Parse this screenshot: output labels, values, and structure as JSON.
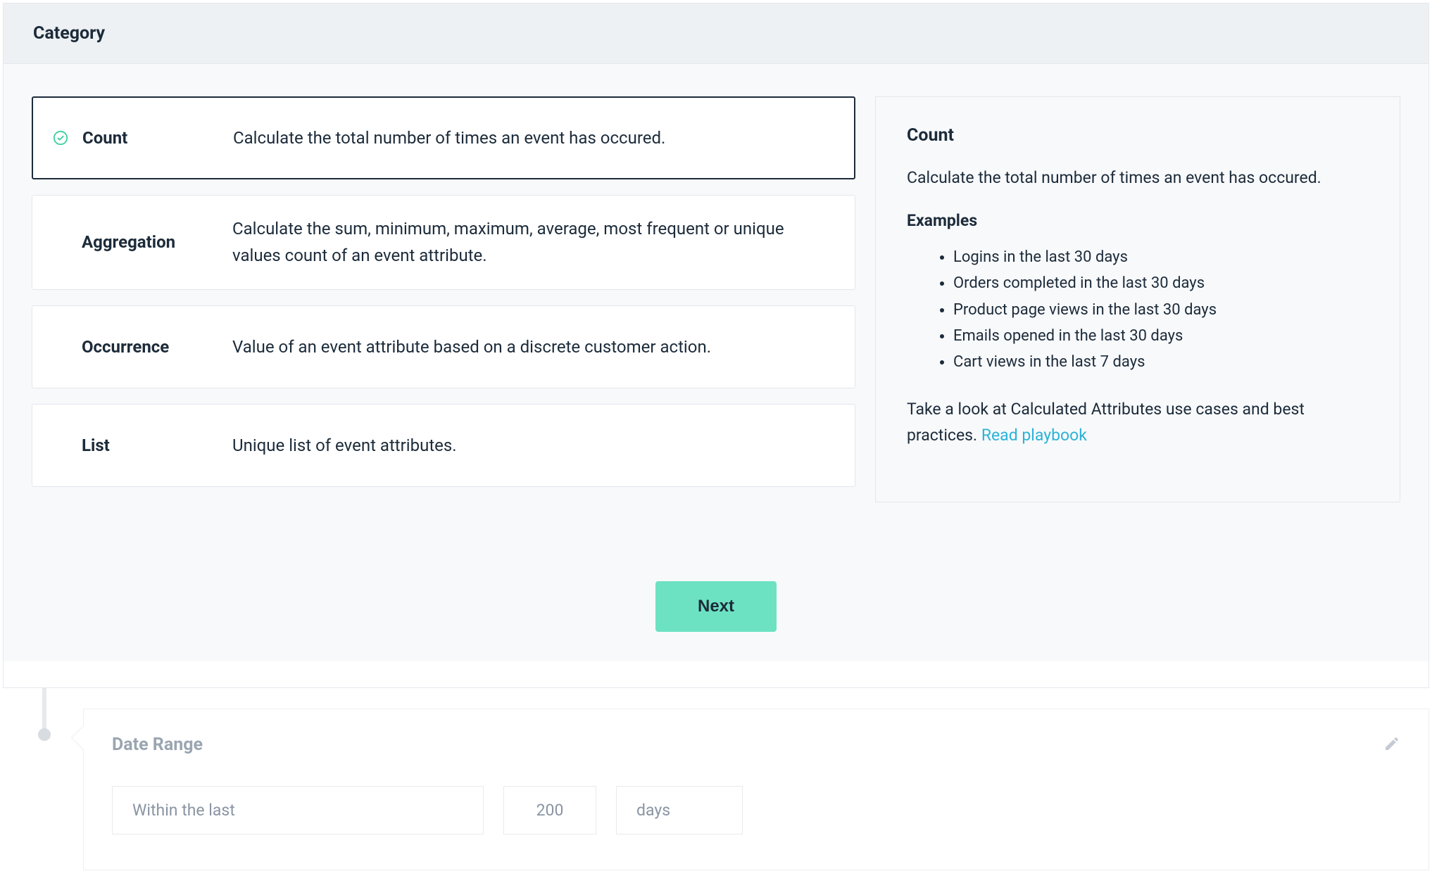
{
  "header": {
    "title": "Category"
  },
  "options": [
    {
      "key": "count",
      "title": "Count",
      "desc": "Calculate the total number of times an event has occured.",
      "selected": true
    },
    {
      "key": "aggregation",
      "title": "Aggregation",
      "desc": "Calculate the sum, minimum, maximum, average, most frequent or unique values count of an event attribute.",
      "selected": false
    },
    {
      "key": "occurrence",
      "title": "Occurrence",
      "desc": "Value of an event attribute based on a discrete customer action.",
      "selected": false
    },
    {
      "key": "list",
      "title": "List",
      "desc": "Unique list of event attributes.",
      "selected": false
    }
  ],
  "info": {
    "title": "Count",
    "desc": "Calculate the total number of times an event has occured.",
    "examples_label": "Examples",
    "examples": [
      "Logins in the last 30 days",
      "Orders completed in the last 30 days",
      "Product page views in the last 30 days",
      "Emails opened in the last 30 days",
      "Cart views in the last 7 days"
    ],
    "footer_pre": "Take a look at Calculated Attributes use cases and best practices. ",
    "footer_link": "Read playbook"
  },
  "buttons": {
    "next": "Next"
  },
  "date_range": {
    "title": "Date Range",
    "mode": "Within the last",
    "value": "200",
    "unit": "days"
  }
}
